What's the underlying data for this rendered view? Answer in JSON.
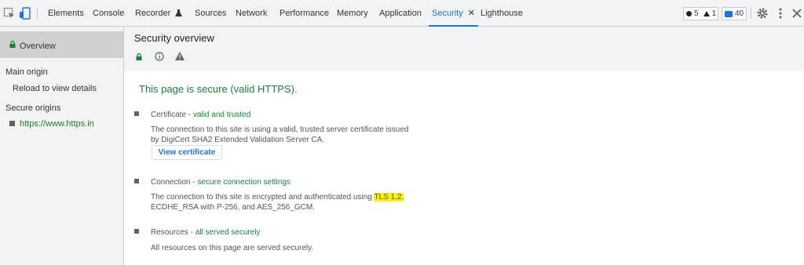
{
  "toolbar": {
    "tabs": [
      {
        "label": "Elements"
      },
      {
        "label": "Console"
      },
      {
        "label": "Recorder"
      },
      {
        "label": "Sources"
      },
      {
        "label": "Network"
      },
      {
        "label": "Performance"
      },
      {
        "label": "Memory"
      },
      {
        "label": "Application"
      },
      {
        "label": "Security"
      },
      {
        "label": "Lighthouse"
      }
    ],
    "active_tab": "Security",
    "errors_count": "5",
    "warnings_count": "1",
    "issues_count": "40",
    "accent_color": "#1a73e8"
  },
  "sidebar": {
    "overview_label": "Overview",
    "main_origin_label": "Main origin",
    "reload_label": "Reload to view details",
    "secure_origins_label": "Secure origins",
    "origin_url": "https://www.https.in"
  },
  "main": {
    "title": "Security overview",
    "secure_message": "This page is secure (valid HTTPS).",
    "certificate": {
      "label": "Certificate",
      "status": "valid and trusted",
      "desc_line1": "The connection to this site is using a valid, trusted server certificate issued",
      "desc_line2": "by DigiCert SHA2 Extended Validation Server CA.",
      "button": "View certificate"
    },
    "connection": {
      "label": "Connection",
      "status": "secure connection settings",
      "desc_line1_prefix": "The connection to this site is encrypted and authenticated using ",
      "desc_line1_highlight": "TLS 1.2,",
      "desc_line2": "ECDHE_RSA with P-256, and AES_256_GCM."
    },
    "resources": {
      "label": "Resources",
      "status": "all served securely",
      "desc": "All resources on this page are served securely."
    },
    "secure_color": "#188038",
    "highlight_color": "#fff200"
  }
}
